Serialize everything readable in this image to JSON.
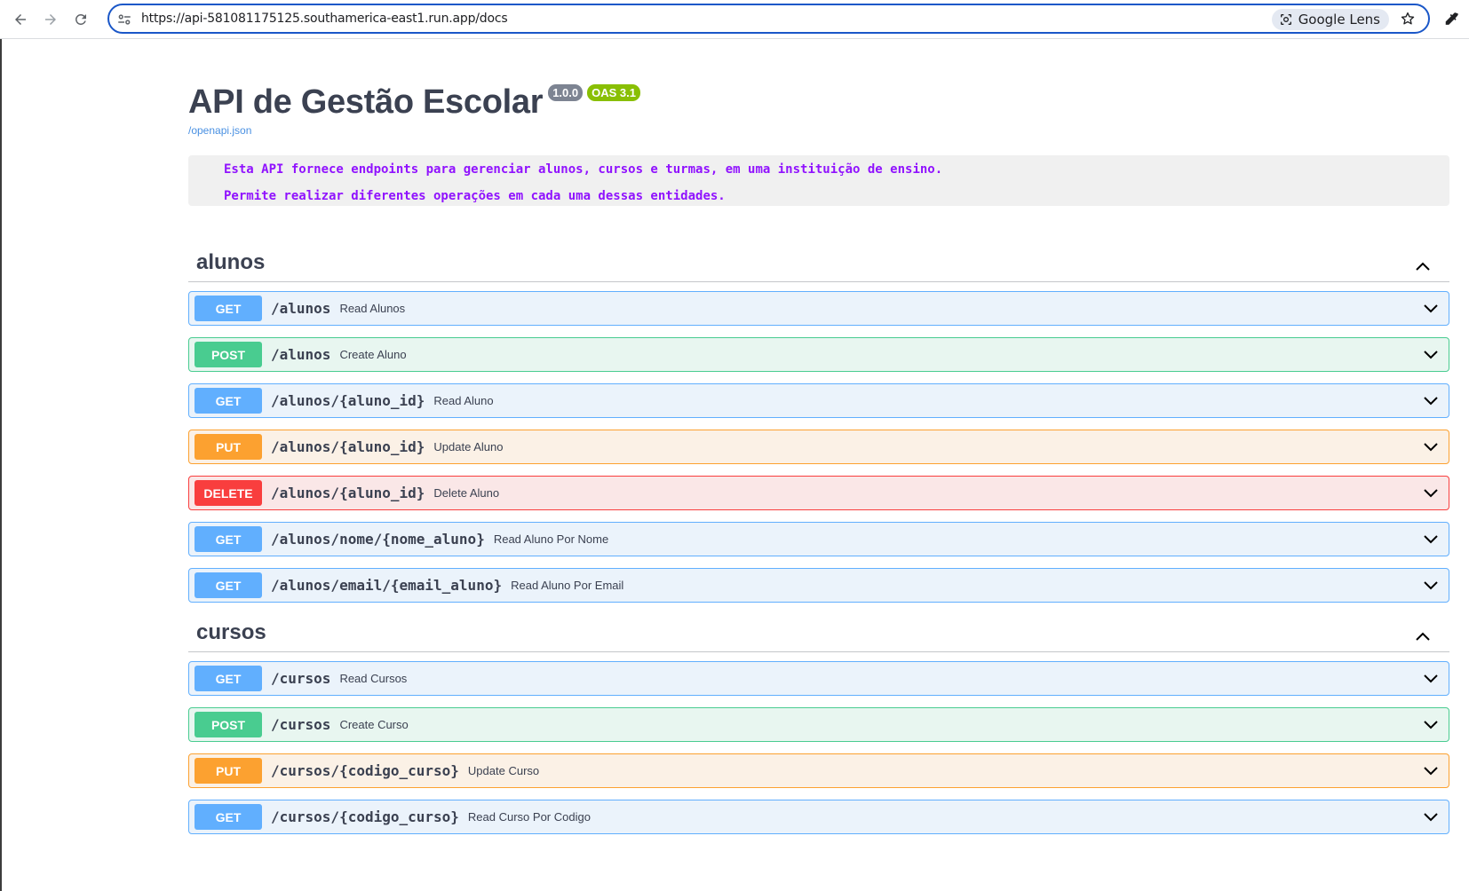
{
  "browser": {
    "url": "https://api-581081175125.southamerica-east1.run.app/docs",
    "lens_label": "Google Lens"
  },
  "info": {
    "title": "API de Gestão Escolar",
    "version": "1.0.0",
    "oas": "OAS 3.1",
    "spec_link": "/openapi.json",
    "description_lines": [
      "Esta API fornece endpoints para gerenciar alunos, cursos e turmas, em uma instituição de ensino.",
      "Permite realizar diferentes operações em cada uma dessas entidades."
    ]
  },
  "tags": [
    {
      "name": "alunos",
      "operations": [
        {
          "method": "GET",
          "path": "/alunos",
          "summary": "Read Alunos"
        },
        {
          "method": "POST",
          "path": "/alunos",
          "summary": "Create Aluno"
        },
        {
          "method": "GET",
          "path": "/alunos/{aluno_id}",
          "summary": "Read Aluno"
        },
        {
          "method": "PUT",
          "path": "/alunos/{aluno_id}",
          "summary": "Update Aluno"
        },
        {
          "method": "DELETE",
          "path": "/alunos/{aluno_id}",
          "summary": "Delete Aluno"
        },
        {
          "method": "GET",
          "path": "/alunos/nome/{nome_aluno}",
          "summary": "Read Aluno Por Nome"
        },
        {
          "method": "GET",
          "path": "/alunos/email/{email_aluno}",
          "summary": "Read Aluno Por Email"
        }
      ]
    },
    {
      "name": "cursos",
      "operations": [
        {
          "method": "GET",
          "path": "/cursos",
          "summary": "Read Cursos"
        },
        {
          "method": "POST",
          "path": "/cursos",
          "summary": "Create Curso"
        },
        {
          "method": "PUT",
          "path": "/cursos/{codigo_curso}",
          "summary": "Update Curso"
        },
        {
          "method": "GET",
          "path": "/cursos/{codigo_curso}",
          "summary": "Read Curso Por Codigo"
        }
      ]
    }
  ],
  "colors": {
    "get": "#61affe",
    "post": "#49cc90",
    "put": "#fca130",
    "delete": "#f93e3e",
    "description_text": "#9012fe",
    "link": "#4990e2"
  }
}
